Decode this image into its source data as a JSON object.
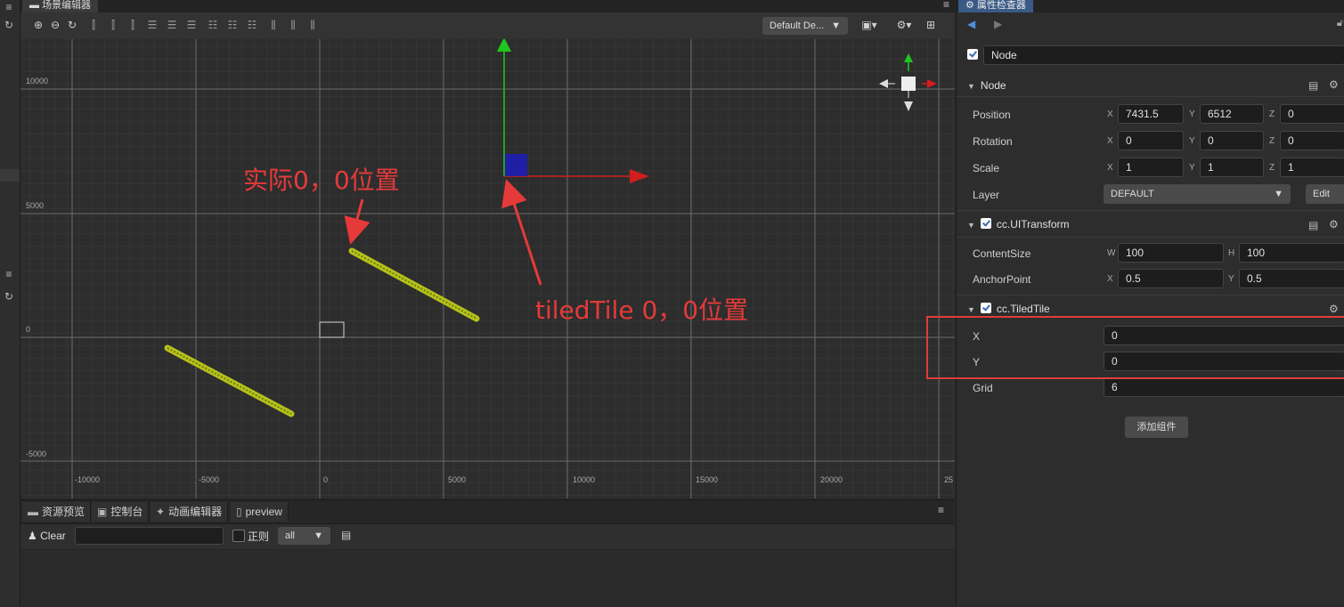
{
  "scene": {
    "tab_label": "场景编辑器",
    "camera_select": "Default De...",
    "ruler_x": [
      "-10000",
      "-5000",
      "0",
      "5000",
      "10000",
      "15000",
      "20000",
      "25"
    ],
    "ruler_y": [
      "10000",
      "5000",
      "0",
      "-5000"
    ]
  },
  "annotations": {
    "actual_origin": "实际0，0位置",
    "tiledtile_origin": "tiledTile 0，0位置"
  },
  "console": {
    "tabs": [
      "资源预览",
      "控制台",
      "动画编辑器",
      "preview"
    ],
    "clear_label": "Clear",
    "filter_value": "",
    "regex_label": "正则",
    "level_select": "all"
  },
  "inspector": {
    "tab_label": "属性检查器",
    "node_name": "Node",
    "node_section": "Node",
    "position_label": "Position",
    "position": {
      "x": "7431.5",
      "y": "6512",
      "z": "0"
    },
    "rotation_label": "Rotation",
    "rotation": {
      "x": "0",
      "y": "0",
      "z": "0"
    },
    "scale_label": "Scale",
    "scale": {
      "x": "1",
      "y": "1",
      "z": "1"
    },
    "layer_label": "Layer",
    "layer_value": "DEFAULT",
    "edit_label": "Edit",
    "uitransform_section": "cc.UITransform",
    "contentsize_label": "ContentSize",
    "contentsize": {
      "w": "100",
      "h": "100"
    },
    "anchor_label": "AnchorPoint",
    "anchor": {
      "x": "0.5",
      "y": "0.5"
    },
    "tiledtile_section": "cc.TiledTile",
    "tile_x_label": "X",
    "tile_x": "0",
    "tile_y_label": "Y",
    "tile_y": "0",
    "grid_label": "Grid",
    "grid_value": "6",
    "add_component_label": "添加组件",
    "axis": {
      "x": "X",
      "y": "Y",
      "z": "Z",
      "w": "W",
      "h": "H"
    }
  },
  "colors": {
    "annotation_red": "#e63a3a",
    "gizmo_green": "#1ec81e",
    "gizmo_red": "#d21e1e",
    "gizmo_blue": "#1e1eb4",
    "tile_yellow": "#b5c21a"
  },
  "icons": [
    "menu-icon",
    "refresh-icon",
    "zoom-in-icon",
    "zoom-out-icon",
    "reset-icon",
    "gear-icon",
    "camera-icon",
    "book-icon",
    "clear-icon",
    "doc-icon"
  ]
}
